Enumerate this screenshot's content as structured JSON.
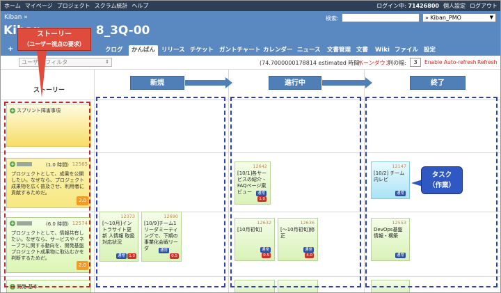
{
  "topnav": {
    "items": [
      "ホーム",
      "マイページ",
      "プロジェクト",
      "スクラム統計",
      "ヘルプ"
    ],
    "login_label": "ログイン中:",
    "login_user": "71426800",
    "personal_settings": "個人設定",
    "logout": "ログアウト"
  },
  "header": {
    "breadcrumb": "Kiban »",
    "title": "Kiban",
    "title_suffix": "8_3Q-00",
    "search_label": "検索:",
    "search_value": "",
    "project_selected": "» Kiban_PMO"
  },
  "tabs": {
    "plus": "+",
    "items": [
      "クログ",
      "かんばん",
      "リリース",
      "チケット",
      "ガントチャート",
      "カレンダー",
      "ニュース",
      "文書管理",
      "文書",
      "Wiki",
      "ファイル",
      "設定"
    ],
    "active": "かんばん"
  },
  "toolbar": {
    "user_filter": "ユーザー フィルタ",
    "estimate": "(74.7000000178814 estimated 時間)",
    "burndown": "バーンダウン",
    "column_width_label": "列の幅:",
    "column_width_value": "3",
    "auto_refresh": "Enable Auto-refresh",
    "refresh": "Refresh"
  },
  "board": {
    "story_header": "ストーリー",
    "columns": [
      "新規",
      "進行中",
      "終了"
    ],
    "stories": [
      {
        "title": "スプリント障害事項",
        "hours": "",
        "id": "",
        "desc": "",
        "points": ""
      },
      {
        "title": "",
        "hours": "(1.0 時間)",
        "id": "12565",
        "desc": "プロジェクトとして、成果を公開したい。なぜなら、プロジェクト成果物を広く普及させ、利用者に貢献するためだ。",
        "points": "3.0"
      },
      {
        "title": "",
        "hours": "(6.0 時間)",
        "id": "12574",
        "desc": "プロジェクトとして、情報共有したい。なぜなら、サービスやイネーブラに関する動向を、開発基盤プロジェクト成果物に取込むかを判断するためだ。",
        "points": "2.0"
      },
      {
        "title": "開発 基本",
        "hours": "",
        "id": "",
        "desc": "",
        "points": ""
      }
    ],
    "cards": [
      {
        "id": "12642",
        "text": "[10/1]各サービスの紹介・FAQページ案 ビュー",
        "status": "通常",
        "hours": "1.0"
      },
      {
        "id": "12147",
        "text": "[10/2] チーム内レビ",
        "status": "通常",
        "hours": ""
      },
      {
        "id": "12373",
        "text": "[～10月]イントラサイト更新 人情報 取扱 対応状況",
        "status": "通常",
        "hours": "1.0"
      },
      {
        "id": "12690",
        "text": "[10/9]チーム1リーダミーティングで、下期の事業化会戦リーダ",
        "status": "通常",
        "hours": "0.5"
      },
      {
        "id": "12632",
        "text": "[10月初旬]",
        "status": "通常",
        "hours": "0.5"
      },
      {
        "id": "12636",
        "text": "[～10月初旬]修正",
        "status": "通常",
        "hours": "4.0"
      },
      {
        "id": "12553",
        "text": "DevOps基盤 情報・構築",
        "status": "通常",
        "hours": ""
      }
    ]
  },
  "annotations": {
    "story_title": "ストーリー",
    "story_sub": "（ユーザー視点の要求）",
    "task_title": "タスク",
    "task_sub": "（作業）"
  }
}
